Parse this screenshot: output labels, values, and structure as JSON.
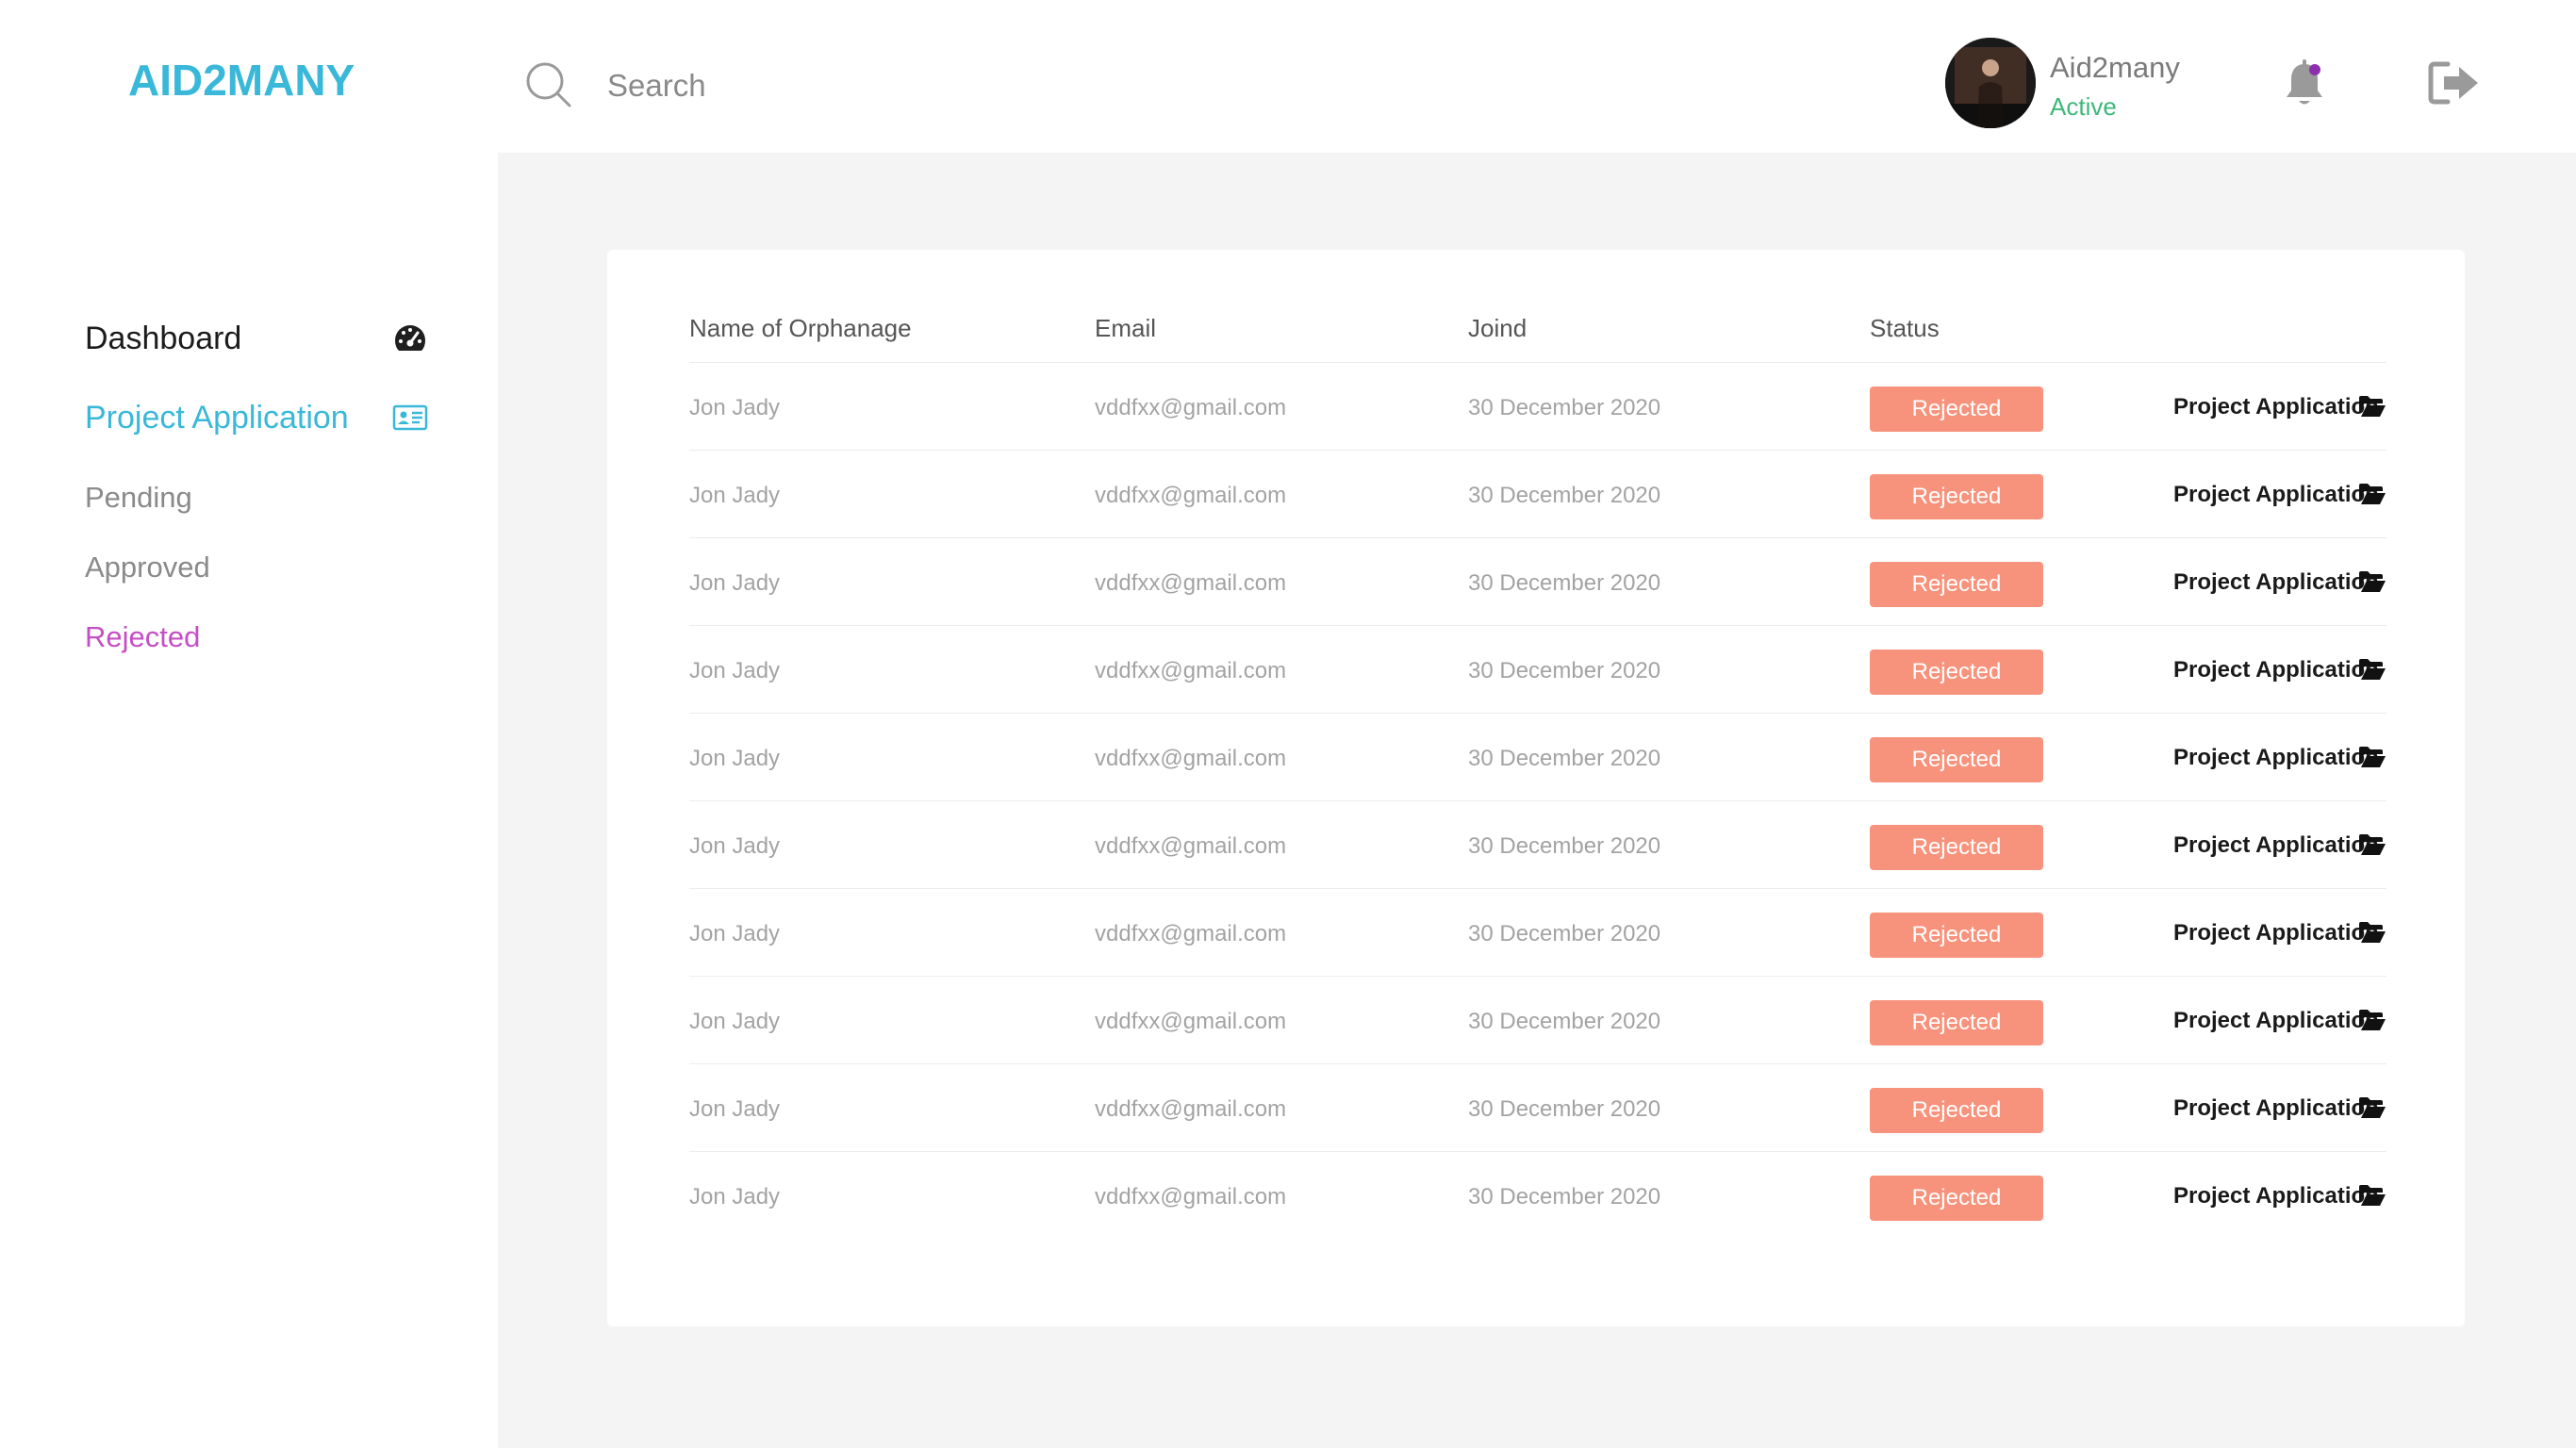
{
  "header": {
    "logo": "AID2MANY",
    "search_placeholder": "Search",
    "user_name": "Aid2many",
    "user_status": "Active",
    "icons": [
      "search-icon",
      "bell-icon",
      "logout-icon"
    ]
  },
  "sidebar": {
    "items": [
      {
        "label": "Dashboard",
        "icon": "dashboard-gauge-icon"
      },
      {
        "label": "Project Application",
        "icon": "id-card-icon",
        "active": true
      },
      {
        "label": "Pending"
      },
      {
        "label": "Approved"
      },
      {
        "label": "Rejected",
        "selected": true
      }
    ]
  },
  "table": {
    "headers": [
      "Name of Orphanage",
      "Email",
      "Joind",
      "Status"
    ],
    "rows": [
      {
        "name": "Jon Jady",
        "email": "vddfxx@gmail.com",
        "joined": "30 December 2020",
        "status": "Rejected",
        "link": "Project Application"
      },
      {
        "name": "Jon Jady",
        "email": "vddfxx@gmail.com",
        "joined": "30 December 2020",
        "status": "Rejected",
        "link": "Project Application"
      },
      {
        "name": "Jon Jady",
        "email": "vddfxx@gmail.com",
        "joined": "30 December 2020",
        "status": "Rejected",
        "link": "Project Application"
      },
      {
        "name": "Jon Jady",
        "email": "vddfxx@gmail.com",
        "joined": "30 December 2020",
        "status": "Rejected",
        "link": "Project Application"
      },
      {
        "name": "Jon Jady",
        "email": "vddfxx@gmail.com",
        "joined": "30 December 2020",
        "status": "Rejected",
        "link": "Project Application"
      },
      {
        "name": "Jon Jady",
        "email": "vddfxx@gmail.com",
        "joined": "30 December 2020",
        "status": "Rejected",
        "link": "Project Application"
      },
      {
        "name": "Jon Jady",
        "email": "vddfxx@gmail.com",
        "joined": "30 December 2020",
        "status": "Rejected",
        "link": "Project Application"
      },
      {
        "name": "Jon Jady",
        "email": "vddfxx@gmail.com",
        "joined": "30 December 2020",
        "status": "Rejected",
        "link": "Project Application"
      },
      {
        "name": "Jon Jady",
        "email": "vddfxx@gmail.com",
        "joined": "30 December 2020",
        "status": "Rejected",
        "link": "Project Application"
      },
      {
        "name": "Jon Jady",
        "email": "vddfxx@gmail.com",
        "joined": "30 December 2020",
        "status": "Rejected",
        "link": "Project Application"
      }
    ]
  },
  "colors": {
    "brand": "#3ab8d9",
    "active_status": "#3cb878",
    "rejected_badge": "#f7937c",
    "rejected_nav": "#c44fc4",
    "notification_dot": "#8e2fb0"
  }
}
